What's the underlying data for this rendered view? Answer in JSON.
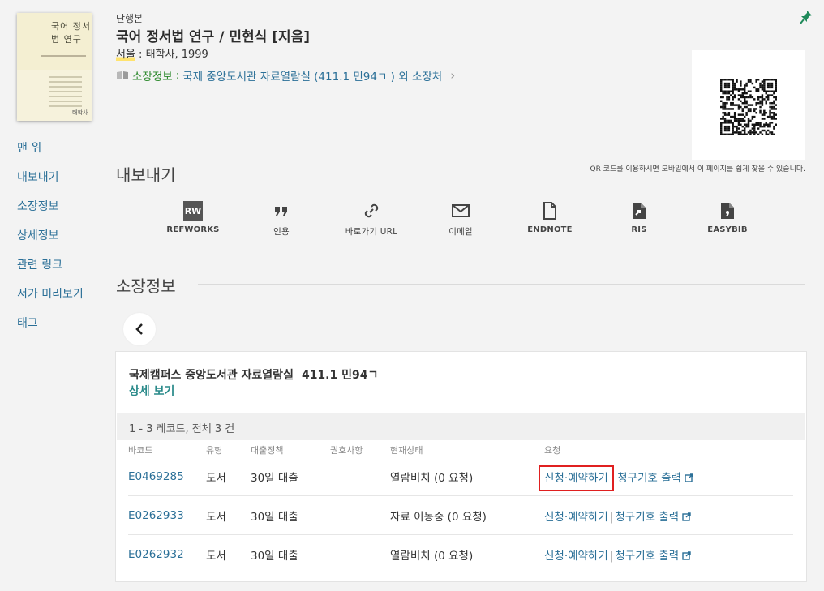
{
  "book": {
    "type_label": "단행본",
    "title": "국어 정서법 연구 / 민현식 [지음]",
    "publisher_place": "서울",
    "publisher_rest": " : 태학사, 1999",
    "holding_label": "소장정보",
    "holding_value": "국제 중앙도서관  자료열람실 (411.1 민94ㄱ ) 외 소장처",
    "cover_text": "국어 정서법 연구",
    "cover_pub": "태학사"
  },
  "qr": {
    "caption": "QR 코드를 이용하시면 모바일에서 이 페이지를 쉽게 찾을 수 있습니다."
  },
  "nav": {
    "items": [
      {
        "label": "맨 위"
      },
      {
        "label": "내보내기"
      },
      {
        "label": "소장정보"
      },
      {
        "label": "상세정보"
      },
      {
        "label": "관련 링크"
      },
      {
        "label": "서가 미리보기"
      },
      {
        "label": "태그"
      }
    ]
  },
  "export": {
    "title": "내보내기",
    "items": [
      {
        "label": "REFWORKS",
        "icon": "refworks-icon",
        "badge": "RW"
      },
      {
        "label": "인용",
        "icon": "quote-icon"
      },
      {
        "label": "바로가기 URL",
        "icon": "link-icon"
      },
      {
        "label": "이메일",
        "icon": "email-icon"
      },
      {
        "label": "ENDNOTE",
        "icon": "endnote-file-icon"
      },
      {
        "label": "RIS",
        "icon": "ris-file-icon"
      },
      {
        "label": "EASYBIB",
        "icon": "easybib-file-icon"
      }
    ]
  },
  "holdings": {
    "title": "소장정보",
    "location": "국제캠퍼스 중앙도서관  자료열람실",
    "call_number": "411.1 민94ㄱ",
    "detail_link": "상세 보기",
    "record_count": "1 - 3 레코드, 전체 3 건",
    "columns": [
      "바코드",
      "유형",
      "대출정책",
      "권호사항",
      "현재상태",
      "요청"
    ],
    "rows": [
      {
        "barcode": "E0469285",
        "type": "도서",
        "policy": "30일 대출",
        "volume": "",
        "status": "열람비치 (0 요청)",
        "request": "신청·예약하기",
        "print": "청구기호 출력"
      },
      {
        "barcode": "E0262933",
        "type": "도서",
        "policy": "30일 대출",
        "volume": "",
        "status": "자료 이동중 (0 요청)",
        "request": "신청·예약하기",
        "print": "청구기호 출력"
      },
      {
        "barcode": "E0262932",
        "type": "도서",
        "policy": "30일 대출",
        "volume": "",
        "status": "열람비치 (0 요청)",
        "request": "신청·예약하기",
        "print": "청구기호 출력"
      }
    ]
  },
  "colors": {
    "link": "#2a6f97",
    "holding_label": "#2e8a2e",
    "detail_link": "#2a8a8a",
    "highlight_box": "#e02020",
    "pin": "#1f8a5a"
  }
}
